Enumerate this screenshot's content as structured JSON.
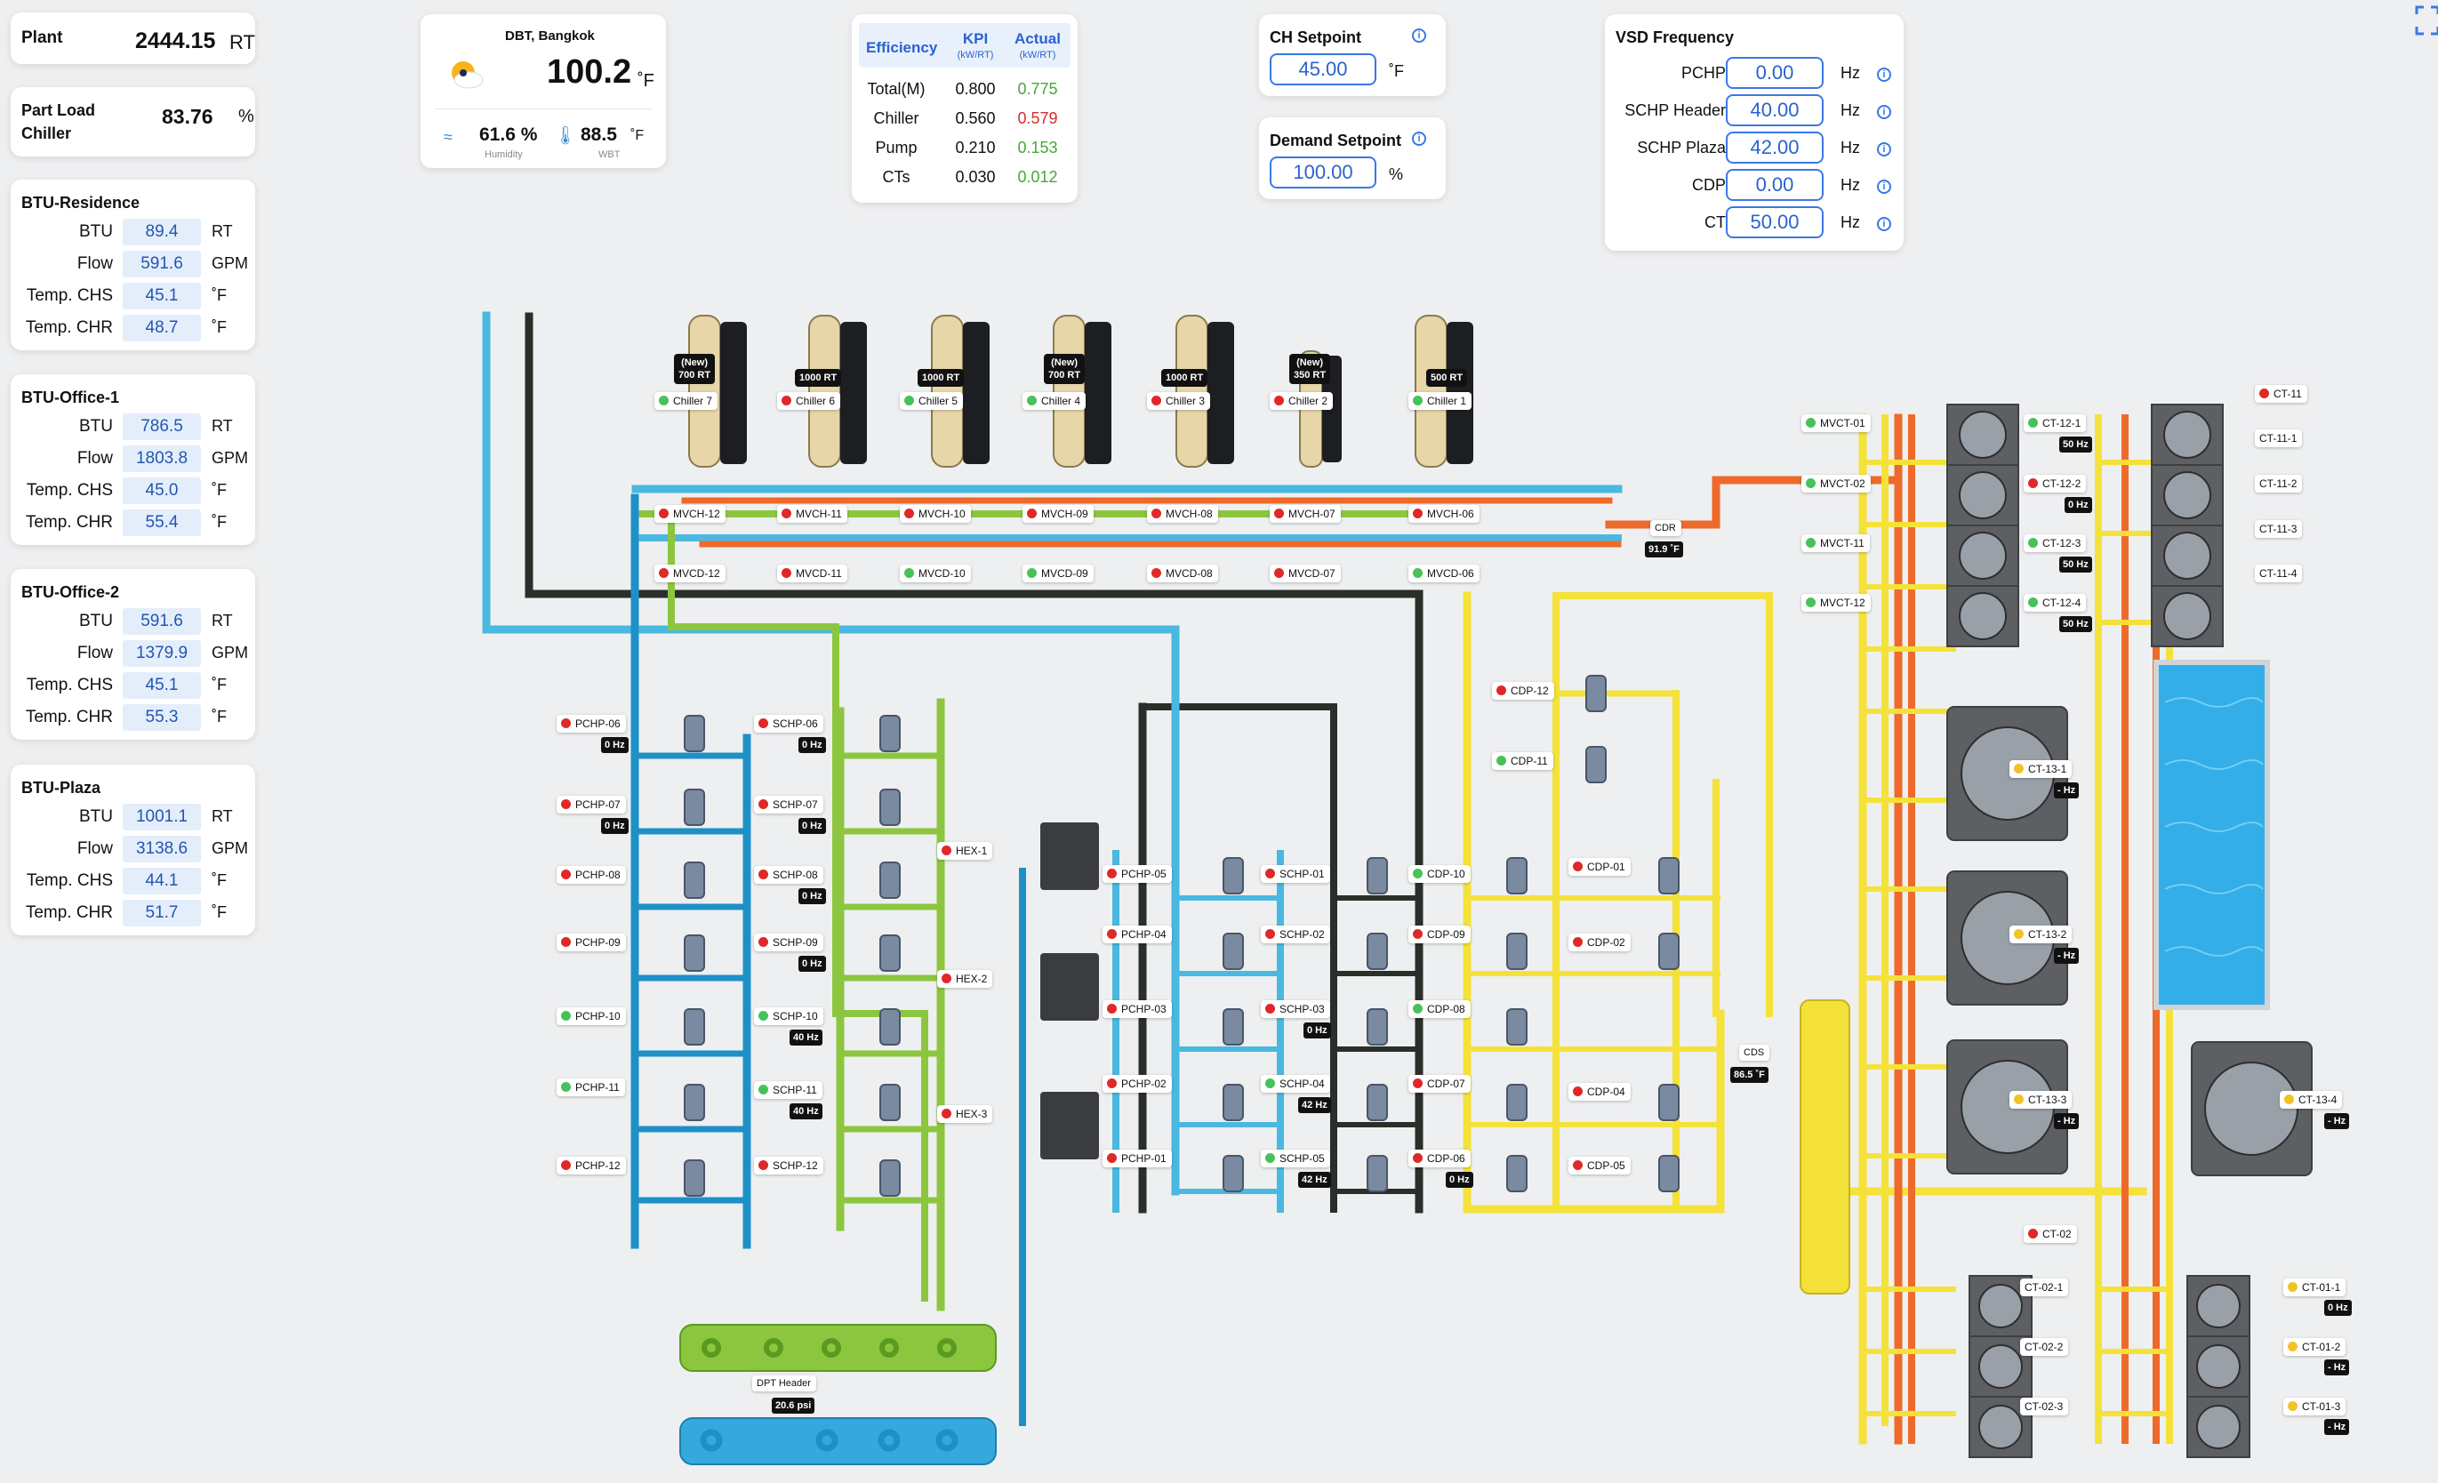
{
  "plant": {
    "label": "Plant",
    "value": "2444.15",
    "unit": "RT"
  },
  "part_load": {
    "label_line1": "Part Load",
    "label_line2": "Chiller",
    "value": "83.76",
    "unit": "%"
  },
  "btu_panels": [
    {
      "title": "BTU-Residence",
      "rows": [
        {
          "label": "BTU",
          "value": "89.4",
          "unit": "RT"
        },
        {
          "label": "Flow",
          "value": "591.6",
          "unit": "GPM"
        },
        {
          "label": "Temp. CHS",
          "value": "45.1",
          "unit": "˚F"
        },
        {
          "label": "Temp. CHR",
          "value": "48.7",
          "unit": "˚F"
        }
      ]
    },
    {
      "title": "BTU-Office-1",
      "rows": [
        {
          "label": "BTU",
          "value": "786.5",
          "unit": "RT"
        },
        {
          "label": "Flow",
          "value": "1803.8",
          "unit": "GPM"
        },
        {
          "label": "Temp. CHS",
          "value": "45.0",
          "unit": "˚F"
        },
        {
          "label": "Temp. CHR",
          "value": "55.4",
          "unit": "˚F"
        }
      ]
    },
    {
      "title": "BTU-Office-2",
      "rows": [
        {
          "label": "BTU",
          "value": "591.6",
          "unit": "RT"
        },
        {
          "label": "Flow",
          "value": "1379.9",
          "unit": "GPM"
        },
        {
          "label": "Temp. CHS",
          "value": "45.1",
          "unit": "˚F"
        },
        {
          "label": "Temp. CHR",
          "value": "55.3",
          "unit": "˚F"
        }
      ]
    },
    {
      "title": "BTU-Plaza",
      "rows": [
        {
          "label": "BTU",
          "value": "1001.1",
          "unit": "RT"
        },
        {
          "label": "Flow",
          "value": "3138.6",
          "unit": "GPM"
        },
        {
          "label": "Temp. CHS",
          "value": "44.1",
          "unit": "˚F"
        },
        {
          "label": "Temp. CHR",
          "value": "51.7",
          "unit": "˚F"
        }
      ]
    }
  ],
  "weather": {
    "location": "DBT, Bangkok",
    "dbt_value": "100.2",
    "dbt_unit": "˚F",
    "humidity_value": "61.6 %",
    "humidity_label": "Humidity",
    "wbt_value": "88.5",
    "wbt_unit": "˚F",
    "wbt_label": "WBT"
  },
  "efficiency": {
    "header": "Efficiency",
    "kpi_header": "KPI",
    "kpi_sub": "(kW/RT)",
    "actual_header": "Actual",
    "actual_sub": "(kW/RT)",
    "rows": [
      {
        "label": "Total(M)",
        "kpi": "0.800",
        "actual": "0.775",
        "color": "#47a63a"
      },
      {
        "label": "Chiller",
        "kpi": "0.560",
        "actual": "0.579",
        "color": "#d62b2b"
      },
      {
        "label": "Pump",
        "kpi": "0.210",
        "actual": "0.153",
        "color": "#47a63a"
      },
      {
        "label": "CTs",
        "kpi": "0.030",
        "actual": "0.012",
        "color": "#47a63a"
      }
    ]
  },
  "ch_setpoint": {
    "label": "CH Setpoint",
    "value": "45.00",
    "unit": "˚F"
  },
  "demand_setpoint": {
    "label": "Demand Setpoint",
    "value": "100.00",
    "unit": "%"
  },
  "vsd": {
    "title": "VSD Frequency",
    "rows": [
      {
        "label": "PCHP",
        "value": "0.00",
        "unit": "Hz"
      },
      {
        "label": "SCHP Header",
        "value": "40.00",
        "unit": "Hz"
      },
      {
        "label": "SCHP Plaza",
        "value": "42.00",
        "unit": "Hz"
      },
      {
        "label": "CDP",
        "value": "0.00",
        "unit": "Hz"
      },
      {
        "label": "CT",
        "value": "50.00",
        "unit": "Hz"
      }
    ]
  },
  "chillers": [
    {
      "cap1": "(New)",
      "cap2": "700 RT",
      "name": "Chiller 7",
      "status": "green"
    },
    {
      "cap1": "",
      "cap2": "1000 RT",
      "name": "Chiller 6",
      "status": "red"
    },
    {
      "cap1": "",
      "cap2": "1000 RT",
      "name": "Chiller 5",
      "status": "green"
    },
    {
      "cap1": "(New)",
      "cap2": "700 RT",
      "name": "Chiller 4",
      "status": "green"
    },
    {
      "cap1": "",
      "cap2": "1000 RT",
      "name": "Chiller 3",
      "status": "red"
    },
    {
      "cap1": "(New)",
      "cap2": "350 RT",
      "name": "Chiller 2",
      "status": "red"
    },
    {
      "cap1": "",
      "cap2": "500 RT",
      "name": "Chiller 1",
      "status": "green"
    }
  ],
  "mvch": [
    {
      "name": "MVCH-12",
      "status": "red"
    },
    {
      "name": "MVCH-11",
      "status": "red"
    },
    {
      "name": "MVCH-10",
      "status": "red"
    },
    {
      "name": "MVCH-09",
      "status": "red"
    },
    {
      "name": "MVCH-08",
      "status": "red"
    },
    {
      "name": "MVCH-07",
      "status": "red"
    },
    {
      "name": "MVCH-06",
      "status": "red"
    }
  ],
  "mvcd": [
    {
      "name": "MVCD-12",
      "status": "red"
    },
    {
      "name": "MVCD-11",
      "status": "red"
    },
    {
      "name": "MVCD-10",
      "status": "green"
    },
    {
      "name": "MVCD-09",
      "status": "green"
    },
    {
      "name": "MVCD-08",
      "status": "red"
    },
    {
      "name": "MVCD-07",
      "status": "red"
    },
    {
      "name": "MVCD-06",
      "status": "green"
    }
  ],
  "cdr": {
    "label": "CDR",
    "value": "91.9 ˚F"
  },
  "cds": {
    "label": "CDS",
    "value": "86.5 ˚F"
  },
  "dpt": {
    "label": "DPT Header",
    "value": "20.6 psi"
  },
  "pchp_left": [
    {
      "name": "PCHP-06",
      "status": "red",
      "hz": "0 Hz"
    },
    {
      "name": "PCHP-07",
      "status": "red",
      "hz": "0 Hz"
    },
    {
      "name": "PCHP-08",
      "status": "red",
      "hz": ""
    },
    {
      "name": "PCHP-09",
      "status": "red",
      "hz": ""
    },
    {
      "name": "PCHP-10",
      "status": "green",
      "hz": ""
    },
    {
      "name": "PCHP-11",
      "status": "green",
      "hz": ""
    },
    {
      "name": "PCHP-12",
      "status": "red",
      "hz": ""
    }
  ],
  "schp_left": [
    {
      "name": "SCHP-06",
      "status": "red",
      "hz": "0 Hz"
    },
    {
      "name": "SCHP-07",
      "status": "red",
      "hz": "0 Hz"
    },
    {
      "name": "SCHP-08",
      "status": "red",
      "hz": "0 Hz"
    },
    {
      "name": "SCHP-09",
      "status": "red",
      "hz": "0 Hz"
    },
    {
      "name": "SCHP-10",
      "status": "green",
      "hz": "40 Hz"
    },
    {
      "name": "SCHP-11",
      "status": "green",
      "hz": "40 Hz"
    },
    {
      "name": "SCHP-12",
      "status": "red",
      "hz": ""
    }
  ],
  "hex": [
    {
      "name": "HEX-1",
      "status": "red"
    },
    {
      "name": "HEX-2",
      "status": "red"
    },
    {
      "name": "HEX-3",
      "status": "red"
    }
  ],
  "pchp_right": [
    {
      "name": "PCHP-05",
      "status": "red"
    },
    {
      "name": "PCHP-04",
      "status": "red"
    },
    {
      "name": "PCHP-03",
      "status": "red"
    },
    {
      "name": "PCHP-02",
      "status": "red"
    },
    {
      "name": "PCHP-01",
      "status": "red"
    }
  ],
  "schp_right": [
    {
      "name": "SCHP-01",
      "status": "red",
      "hz": ""
    },
    {
      "name": "SCHP-02",
      "status": "red",
      "hz": ""
    },
    {
      "name": "SCHP-03",
      "status": "red",
      "hz": "0 Hz"
    },
    {
      "name": "SCHP-04",
      "status": "green",
      "hz": "42 Hz"
    },
    {
      "name": "SCHP-05",
      "status": "green",
      "hz": "42 Hz"
    }
  ],
  "cdp_mid": [
    {
      "name": "CDP-10",
      "status": "green",
      "hz": ""
    },
    {
      "name": "CDP-09",
      "status": "red",
      "hz": ""
    },
    {
      "name": "CDP-08",
      "status": "green",
      "hz": ""
    },
    {
      "name": "CDP-07",
      "status": "red",
      "hz": ""
    },
    {
      "name": "CDP-06",
      "status": "red",
      "hz": "0 Hz"
    }
  ],
  "cdp_top": [
    {
      "name": "CDP-12",
      "status": "red"
    },
    {
      "name": "CDP-11",
      "status": "green"
    }
  ],
  "cdp_right": [
    {
      "name": "CDP-01",
      "status": "red"
    },
    {
      "name": "CDP-02",
      "status": "red"
    },
    {
      "name": "CDP-04",
      "status": "red"
    },
    {
      "name": "CDP-05",
      "status": "red"
    }
  ],
  "mvct": [
    {
      "name": "MVCT-01",
      "status": "green"
    },
    {
      "name": "MVCT-02",
      "status": "green"
    },
    {
      "name": "MVCT-11",
      "status": "green"
    },
    {
      "name": "MVCT-12",
      "status": "green"
    }
  ],
  "ct12": [
    {
      "name": "CT-12-1",
      "status": "green",
      "hz": "50 Hz"
    },
    {
      "name": "CT-12-2",
      "status": "red",
      "hz": "0 Hz"
    },
    {
      "name": "CT-12-3",
      "status": "green",
      "hz": "50 Hz"
    },
    {
      "name": "CT-12-4",
      "status": "green",
      "hz": "50 Hz"
    }
  ],
  "ct11": [
    {
      "name": "CT-11",
      "status": "red"
    },
    {
      "name": "CT-11-1",
      "status": ""
    },
    {
      "name": "CT-11-2",
      "status": ""
    },
    {
      "name": "CT-11-3",
      "status": ""
    },
    {
      "name": "CT-11-4",
      "status": ""
    }
  ],
  "ct13": [
    {
      "name": "CT-13-1",
      "status": "yellow",
      "hz": "- Hz"
    },
    {
      "name": "CT-13-2",
      "status": "yellow",
      "hz": "- Hz"
    },
    {
      "name": "CT-13-3",
      "status": "yellow",
      "hz": "- Hz"
    },
    {
      "name": "CT-13-4",
      "status": "yellow",
      "hz": "- Hz"
    }
  ],
  "ct02": [
    {
      "name": "CT-02",
      "status": "red"
    },
    {
      "name": "CT-02-1",
      "status": ""
    },
    {
      "name": "CT-02-2",
      "status": ""
    },
    {
      "name": "CT-02-3",
      "status": ""
    }
  ],
  "ct01": [
    {
      "name": "CT-01-1",
      "status": "yellow",
      "hz": "0 Hz"
    },
    {
      "name": "CT-01-2",
      "status": "yellow",
      "hz": "- Hz"
    },
    {
      "name": "CT-01-3",
      "status": "yellow",
      "hz": "- Hz"
    }
  ],
  "colors": {
    "chilled_water": "#4ab8e0",
    "condenser_supply": "#f4e23a",
    "condenser_return": "#ee6a2a",
    "secondary": "#8cc63f",
    "primary_header": "#1e90c8",
    "dark_pipe": "#2a2f2a"
  }
}
